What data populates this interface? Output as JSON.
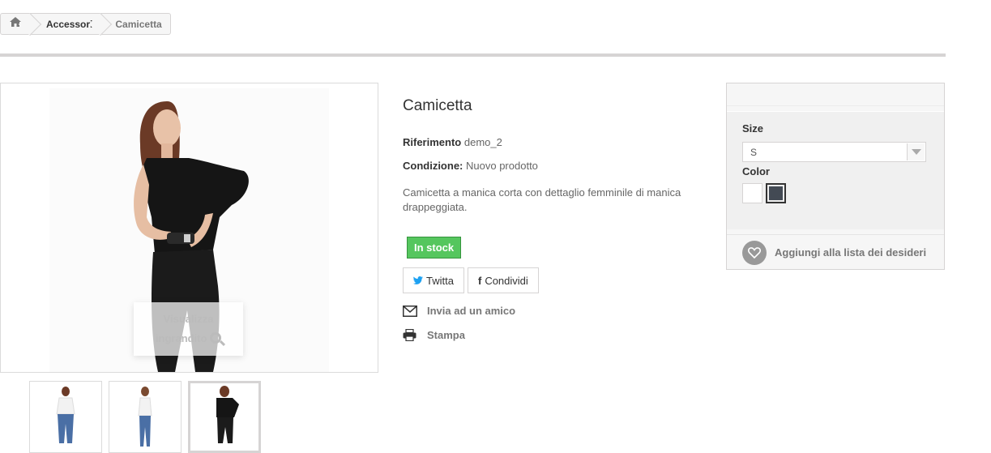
{
  "breadcrumb": {
    "home_icon": "home-icon",
    "category": "Accessori",
    "current": "Camicetta"
  },
  "gallery": {
    "zoom_label_line1": "Visualizza",
    "zoom_label_line2": "ingrandito",
    "zoom_icon": "zoom-in-icon",
    "thumbnails": [
      "thumbnail-1",
      "thumbnail-2",
      "thumbnail-3"
    ],
    "active_thumbnail": 3
  },
  "product": {
    "name": "Camicetta",
    "reference_label": "Riferimento",
    "reference_value": "demo_2",
    "condition_label": "Condizione:",
    "condition_value": "Nuovo prodotto",
    "description": "Camicetta a manica corta con dettaglio femminile di manica drappeggiata.",
    "stock_status": "In stock"
  },
  "social": {
    "tweet_label": "Twitta",
    "share_label": "Condividi"
  },
  "actions": {
    "send_friend": "Invia ad un amico",
    "print": "Stampa"
  },
  "options": {
    "size_label": "Size",
    "size_selected": "S",
    "color_label": "Color",
    "colors": [
      "#ffffff",
      "#434a54"
    ],
    "selected_color_index": 1
  },
  "wishlist": {
    "label": "Aggiungi alla lista dei desideri"
  },
  "colors": {
    "stock_green": "#55c65e",
    "twitter_blue": "#1da1f2",
    "border": "#d6d4d4"
  }
}
